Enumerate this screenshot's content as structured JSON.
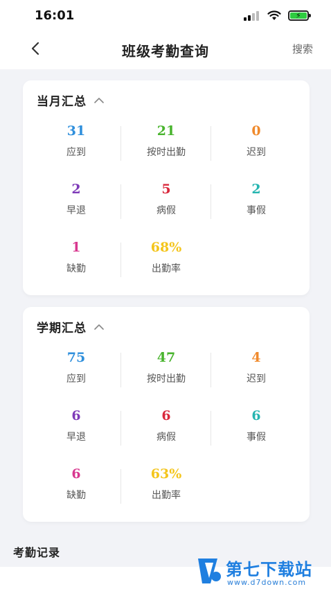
{
  "status_bar": {
    "time": "16:01"
  },
  "nav": {
    "title": "班级考勤查询",
    "search_label": "搜索"
  },
  "month_summary": {
    "title": "当月汇总",
    "stats": [
      {
        "value": "31",
        "label": "应到",
        "color": "#2f8fdc"
      },
      {
        "value": "21",
        "label": "按时出勤",
        "color": "#49b42e"
      },
      {
        "value": "0",
        "label": "迟到",
        "color": "#f08a2c"
      },
      {
        "value": "2",
        "label": "早退",
        "color": "#7e3ab8"
      },
      {
        "value": "5",
        "label": "病假",
        "color": "#d9283c"
      },
      {
        "value": "2",
        "label": "事假",
        "color": "#25b5b0"
      },
      {
        "value": "1",
        "label": "缺勤",
        "color": "#d8378f"
      },
      {
        "value": "68%",
        "label": "出勤率",
        "color": "#f4c51c"
      }
    ]
  },
  "term_summary": {
    "title": "学期汇总",
    "stats": [
      {
        "value": "75",
        "label": "应到",
        "color": "#2f8fdc"
      },
      {
        "value": "47",
        "label": "按时出勤",
        "color": "#49b42e"
      },
      {
        "value": "4",
        "label": "迟到",
        "color": "#f08a2c"
      },
      {
        "value": "6",
        "label": "早退",
        "color": "#7e3ab8"
      },
      {
        "value": "6",
        "label": "病假",
        "color": "#d9283c"
      },
      {
        "value": "6",
        "label": "事假",
        "color": "#25b5b0"
      },
      {
        "value": "6",
        "label": "缺勤",
        "color": "#d8378f"
      },
      {
        "value": "63%",
        "label": "出勤率",
        "color": "#f4c51c"
      }
    ]
  },
  "records": {
    "title": "考勤记录"
  },
  "watermark": {
    "name": "第七下载站",
    "url": "www.d7down.com"
  },
  "icons": [
    "signal-icon",
    "wifi-icon",
    "battery-icon",
    "back-arrow-icon",
    "chevron-up-icon"
  ]
}
